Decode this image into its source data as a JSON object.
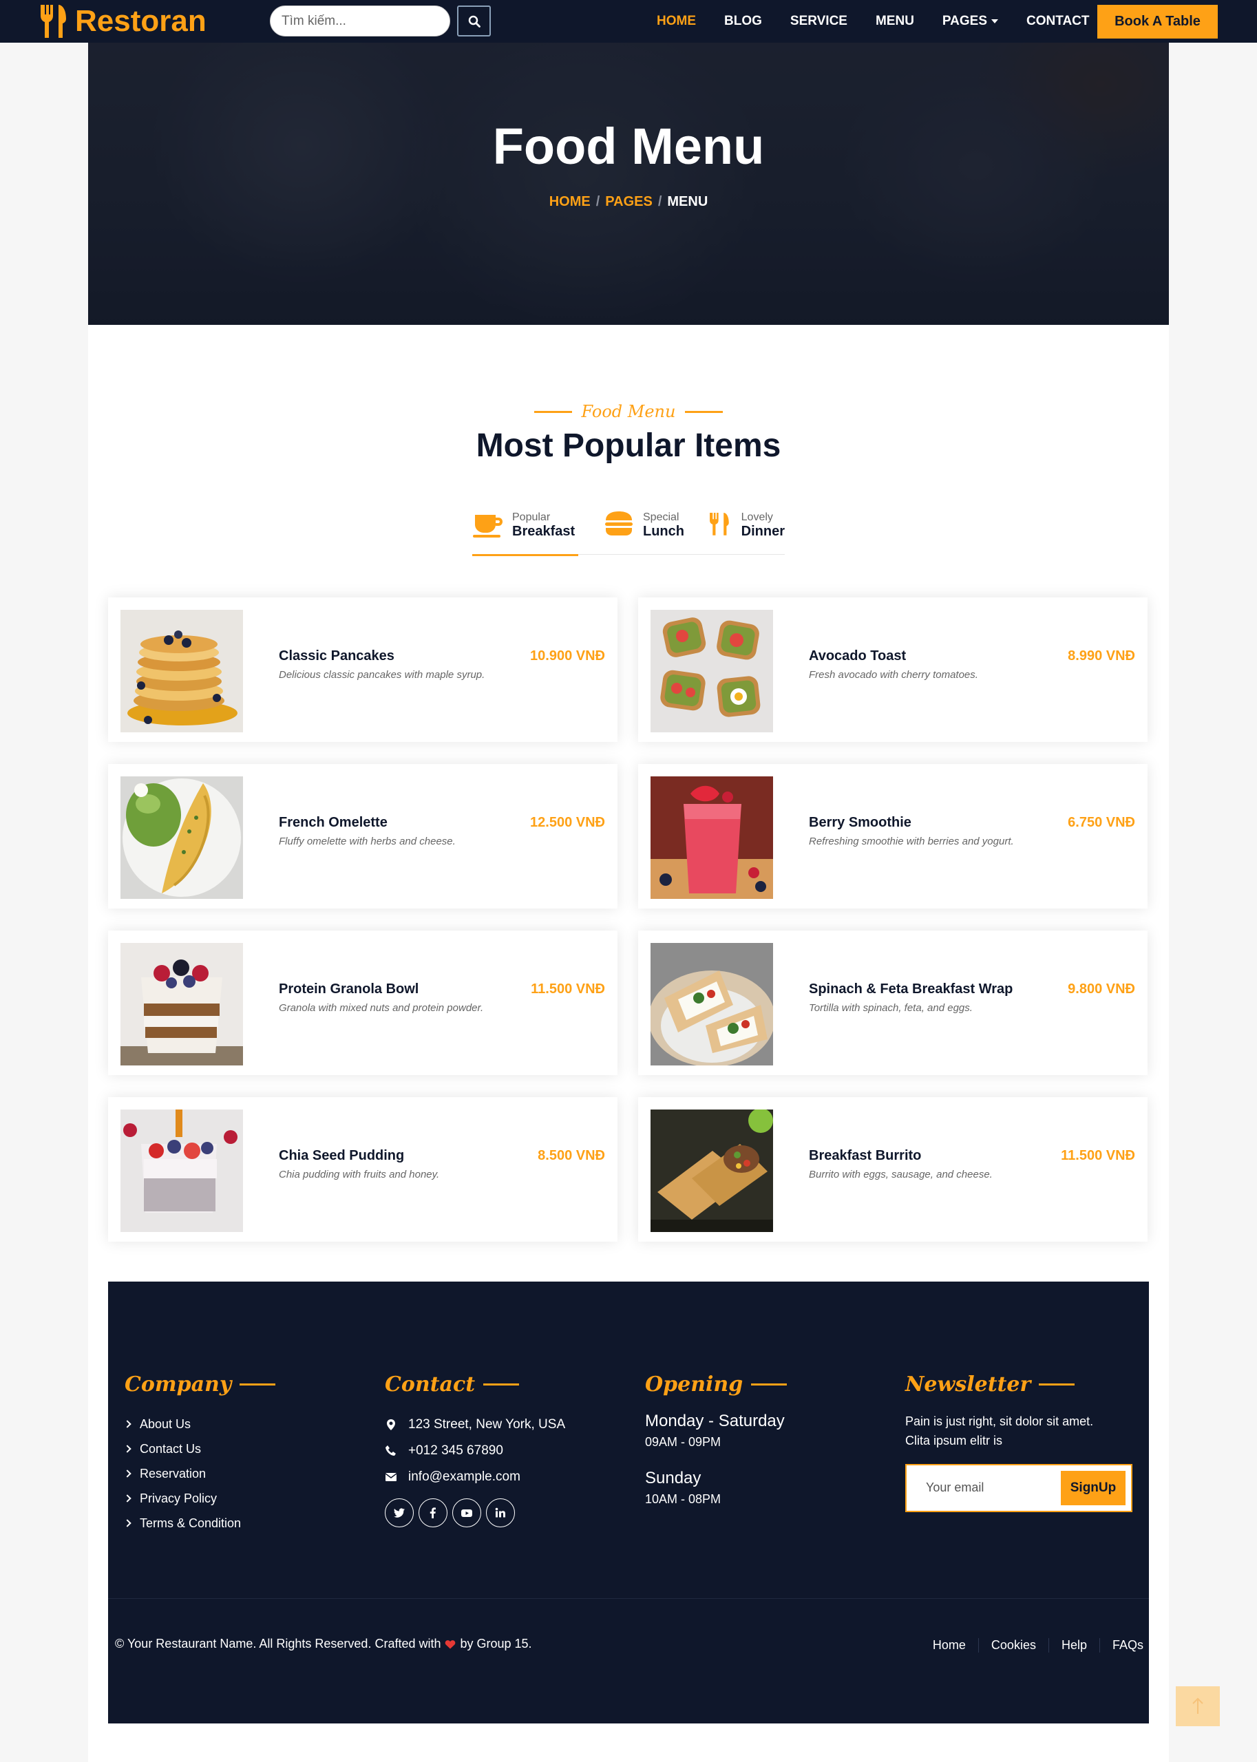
{
  "navbar": {
    "brand": "Restoran",
    "search_placeholder": "Tìm kiếm...",
    "links": [
      "HOME",
      "BLOG",
      "SERVICE",
      "MENU",
      "PAGES",
      "CONTACT"
    ],
    "active_link": "HOME",
    "book_label": "Book A Table"
  },
  "hero": {
    "title": "Food Menu",
    "breadcrumb": [
      "HOME",
      "PAGES",
      "MENU"
    ]
  },
  "section": {
    "subtitle": "Food Menu",
    "title": "Most Popular Items"
  },
  "tabs": [
    {
      "small": "Popular",
      "big": "Breakfast",
      "icon": "coffee-cup-icon",
      "active": true
    },
    {
      "small": "Special",
      "big": "Lunch",
      "icon": "burger-icon",
      "active": false
    },
    {
      "small": "Lovely",
      "big": "Dinner",
      "icon": "utensils-icon",
      "active": false
    }
  ],
  "menu_items": [
    {
      "name": "Classic Pancakes",
      "desc": "Delicious classic pancakes with maple syrup.",
      "price": "10.900 VNĐ",
      "image": "pancakes-photo"
    },
    {
      "name": "Avocado Toast",
      "desc": "Fresh avocado with cherry tomatoes.",
      "price": "8.990 VNĐ",
      "image": "avocado-toast-photo"
    },
    {
      "name": "French Omelette",
      "desc": "Fluffy omelette with herbs and cheese.",
      "price": "12.500 VNĐ",
      "image": "omelette-photo"
    },
    {
      "name": "Berry Smoothie",
      "desc": "Refreshing smoothie with berries and yogurt.",
      "price": "6.750 VNĐ",
      "image": "smoothie-photo"
    },
    {
      "name": "Protein Granola Bowl",
      "desc": "Granola with mixed nuts and protein powder.",
      "price": "11.500 VNĐ",
      "image": "granola-photo"
    },
    {
      "name": "Spinach & Feta Breakfast Wrap",
      "desc": "Tortilla with spinach, feta, and eggs.",
      "price": "9.800 VNĐ",
      "image": "wrap-photo"
    },
    {
      "name": "Chia Seed Pudding",
      "desc": "Chia pudding with fruits and honey.",
      "price": "8.500 VNĐ",
      "image": "chia-photo"
    },
    {
      "name": "Breakfast Burrito",
      "desc": "Burrito with eggs, sausage, and cheese.",
      "price": "11.500 VNĐ",
      "image": "burrito-photo"
    }
  ],
  "footer": {
    "company": {
      "title": "Company",
      "links": [
        "About Us",
        "Contact Us",
        "Reservation",
        "Privacy Policy",
        "Terms & Condition"
      ]
    },
    "contact": {
      "title": "Contact",
      "address": "123 Street, New York, USA",
      "phone": "+012 345 67890",
      "email": "info@example.com",
      "socials": [
        "twitter-icon",
        "facebook-icon",
        "youtube-icon",
        "linkedin-icon"
      ]
    },
    "opening": {
      "title": "Opening",
      "day1": "Monday - Saturday",
      "time1": "09AM - 09PM",
      "day2": "Sunday",
      "time2": "10AM - 08PM"
    },
    "newsletter": {
      "title": "Newsletter",
      "text": "Pain is just right, sit dolor sit amet. Clita ipsum elitr is",
      "placeholder": "Your email",
      "button": "SignUp"
    },
    "copyright_a": "© Your Restaurant Name. All Rights Reserved. Crafted with",
    "copyright_b": "by Group 15.",
    "menu": [
      "Home",
      "Cookies",
      "Help",
      "FAQs"
    ]
  },
  "colors": {
    "primary": "#fea116",
    "dark": "#0f172b"
  }
}
